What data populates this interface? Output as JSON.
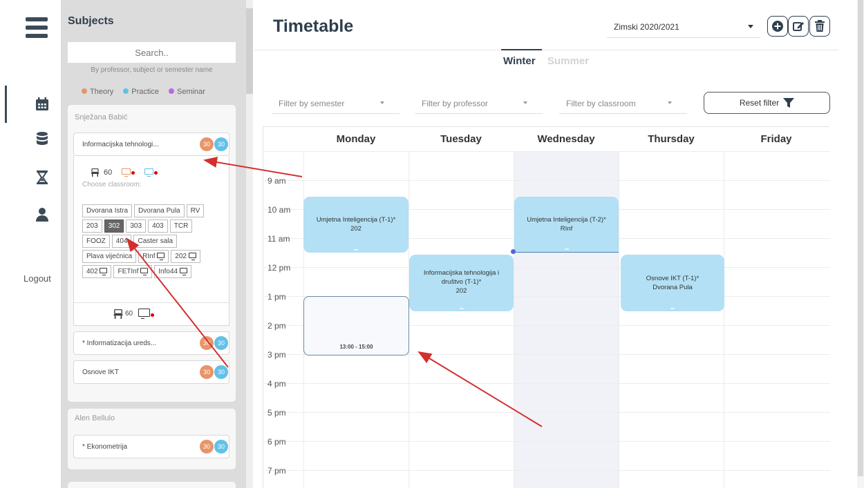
{
  "nav": {
    "menu_icon": "hamburger-icon",
    "items": [
      {
        "icon": "calendar-icon",
        "active": true
      },
      {
        "icon": "database-icon",
        "active": false
      },
      {
        "icon": "hourglass-icon",
        "active": false
      },
      {
        "icon": "user-icon",
        "active": false
      }
    ],
    "logout_label": "Logout"
  },
  "subjects": {
    "title": "Subjects",
    "search_placeholder": "Search..",
    "search_hint": "By professor, subject or semester name",
    "legend": [
      {
        "label": "Theory",
        "color": "#e8946a"
      },
      {
        "label": "Practice",
        "color": "#62c1e8"
      },
      {
        "label": "Seminar",
        "color": "#b86ae8"
      }
    ],
    "professors": [
      {
        "name": "Snježana Babić",
        "subjects": [
          {
            "name": "Informacijska tehnologi...",
            "theory": "30",
            "practice": "30"
          },
          {
            "name": "* Informatizacija ureds...",
            "theory": "30",
            "practice": "30"
          },
          {
            "name": "Osnove IKT",
            "theory": "30",
            "practice": "30"
          }
        ],
        "expanded": {
          "capacity": "60",
          "choose_label": "Choose classroom:",
          "rooms": [
            "Dvorana Istra",
            "Dvorana Pula",
            "RV",
            "203",
            "302",
            "303",
            "403",
            "TCR",
            "FOOZ",
            "404",
            "Caster sala",
            "Plava vijećnica",
            "RInf",
            "202",
            "402",
            "FETInf",
            "Info44"
          ],
          "selected_room": "302",
          "footer_capacity": "60"
        }
      },
      {
        "name": "Alen Bellulo",
        "subjects": [
          {
            "name": "* Ekonometrija",
            "theory": "30",
            "practice": "30"
          }
        ]
      }
    ]
  },
  "main": {
    "title": "Timetable",
    "semester_value": "Zimski 2020/2021",
    "toolbar_icons": [
      "plus-circle-icon",
      "edit-icon",
      "trash-icon"
    ],
    "tabs": [
      "Winter",
      "Summer"
    ],
    "filters": [
      "Filter by semester",
      "Filter by professor",
      "Filter by classroom"
    ],
    "reset_label": "Reset filter",
    "days": [
      "Monday",
      "Tuesday",
      "Wednesday",
      "Thursday",
      "Friday"
    ],
    "times": [
      "9 am",
      "10 am",
      "11 am",
      "12 pm",
      "1 pm",
      "2 pm",
      "3 pm",
      "4 pm",
      "5 pm",
      "6 pm",
      "7 pm"
    ],
    "events": [
      {
        "line1": "Umjetna Inteligencija (T-1)*",
        "line2": "202"
      },
      {
        "line1": "Umjetna Inteligencija (T-2)*",
        "line2": "RInf"
      },
      {
        "line1": "Informacijska tehnologija i",
        "line2": "društvo (T-1)*",
        "line3": "202"
      },
      {
        "line1": "Osnove IKT (T-1)*",
        "line2": "Dvorana Pula"
      }
    ],
    "selection_label": "13:00 - 15:00"
  },
  "colors": {
    "event": "#b3e0f5",
    "accent": "#2f3e4e",
    "arrow": "#d32f2f"
  }
}
